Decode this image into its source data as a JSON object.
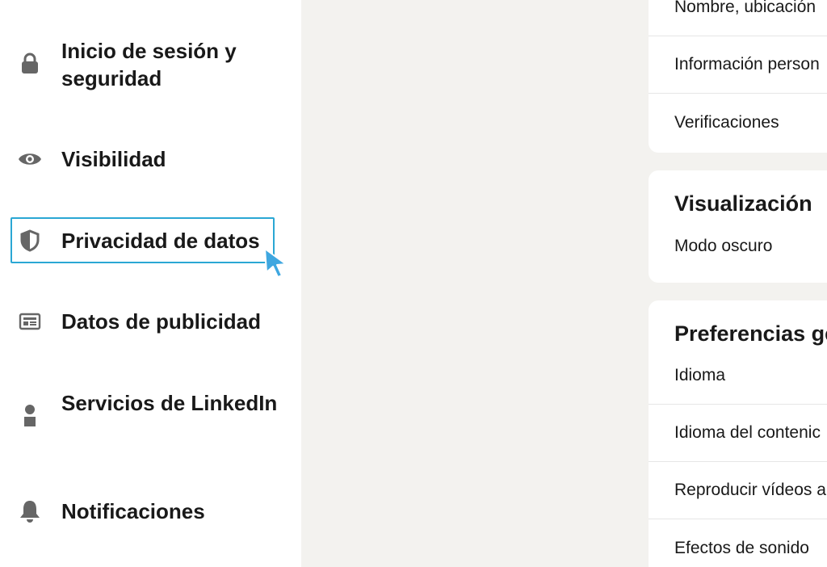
{
  "sidebar": {
    "items": [
      {
        "label": "Inicio de sesión y seguridad",
        "icon": "lock-icon"
      },
      {
        "label": "Visibilidad",
        "icon": "eye-icon"
      },
      {
        "label": "Privacidad de datos",
        "icon": "shield-icon",
        "focused": true
      },
      {
        "label": "Datos de publicidad",
        "icon": "newspaper-icon"
      },
      {
        "label": "Servicios de LinkedIn",
        "icon": "person-icon"
      },
      {
        "label": "Notificaciones",
        "icon": "bell-icon"
      }
    ]
  },
  "main": {
    "account_card": {
      "rows": [
        "Nombre, ubicación",
        "Información person",
        "Verificaciones"
      ]
    },
    "display_card": {
      "title": "Visualización",
      "rows": [
        "Modo oscuro"
      ]
    },
    "preferences_card": {
      "title": "Preferencias ge",
      "rows": [
        "Idioma",
        "Idioma del contenic",
        "Reproducir vídeos a",
        "Efectos de sonido"
      ]
    }
  },
  "colors": {
    "page_background": "#f3f2ef",
    "card_background": "#ffffff",
    "focus_outline": "#2aa7d4",
    "icon_gray": "#666666",
    "text": "#191919"
  }
}
